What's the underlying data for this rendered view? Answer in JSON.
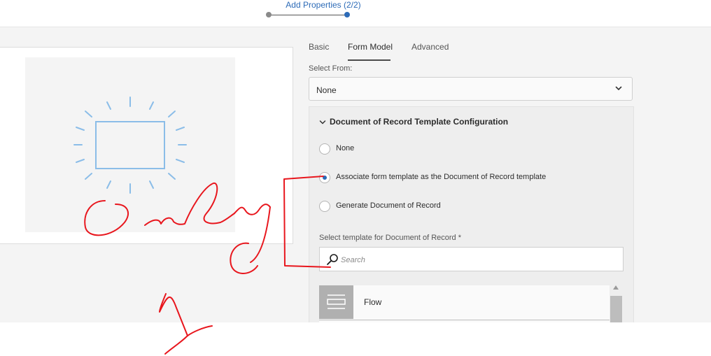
{
  "wizard": {
    "title": "Add Properties (2/2)",
    "steps": 2,
    "current_step": 2
  },
  "tabs": [
    {
      "label": "Basic",
      "active": false
    },
    {
      "label": "Form Model",
      "active": true
    },
    {
      "label": "Advanced",
      "active": false
    }
  ],
  "select_from": {
    "label": "Select From:",
    "value": "None"
  },
  "dor_section": {
    "title": "Document of Record Template Configuration",
    "options": [
      {
        "label": "None",
        "checked": false
      },
      {
        "label": "Associate form template as the Document of Record template",
        "checked": true
      },
      {
        "label": "Generate Document of Record",
        "checked": false
      }
    ],
    "template_label": "Select template for Document of Record *",
    "search_placeholder": "Search",
    "templates": [
      {
        "label": "Flow"
      }
    ]
  },
  "icons": {
    "chevron": "chevron-down-icon",
    "search": "search-icon",
    "template_thumb": "form-lines-icon",
    "preview": "form-thumbnail-icon"
  },
  "colors": {
    "accent": "#2d6bb7",
    "annotation": "#e8161d",
    "preview_stroke": "#8bbde8"
  }
}
